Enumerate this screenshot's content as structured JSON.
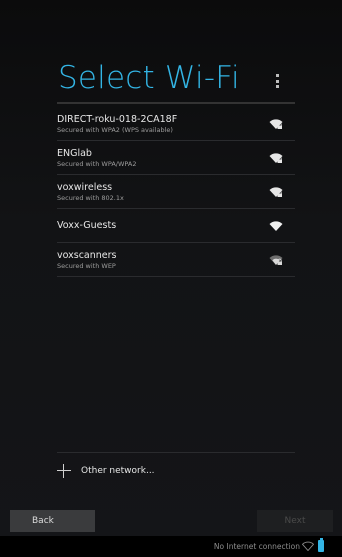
{
  "title": "Select Wi-Fi",
  "networks": [
    {
      "name": "DIRECT-roku-018-2CA18F",
      "security": "Secured with WPA2 (WPS available)",
      "locked": true
    },
    {
      "name": "ENGlab",
      "security": "Secured with WPA/WPA2",
      "locked": true
    },
    {
      "name": "voxwireless",
      "security": "Secured with 802.1x",
      "locked": true
    },
    {
      "name": "Voxx-Guests",
      "security": "",
      "locked": false
    },
    {
      "name": "voxscanners",
      "security": "Secured with WEP",
      "locked": true
    }
  ],
  "other_network_label": "Other network...",
  "back_label": "Back",
  "next_label": "Next",
  "status_text": "No Internet connection",
  "colors": {
    "accent": "#33b5e5"
  }
}
